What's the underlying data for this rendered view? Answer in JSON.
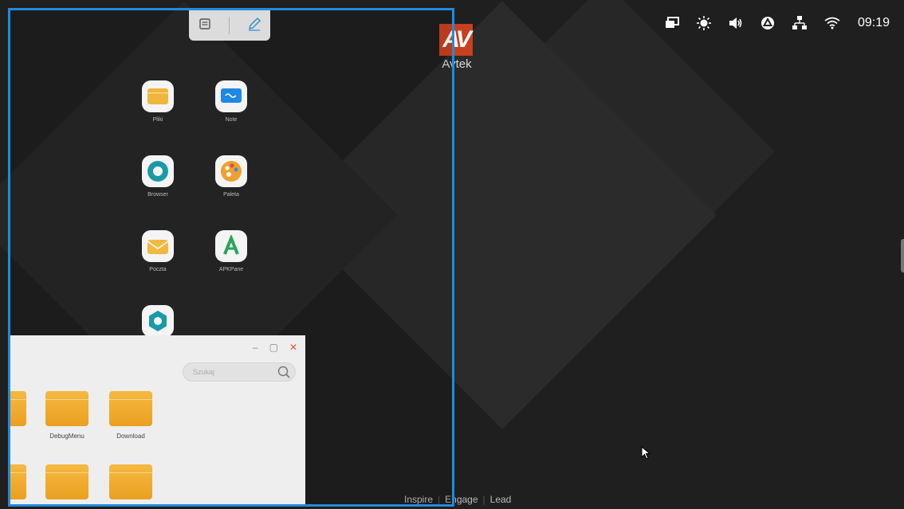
{
  "status_bar": {
    "icons": [
      "screen-mirror-icon",
      "brightness-icon",
      "volume-icon",
      "cloud-sync-icon",
      "ethernet-icon",
      "wifi-icon"
    ],
    "time": "09:19"
  },
  "logo": {
    "mark": "AV",
    "text": "Avtek"
  },
  "tagline": {
    "items": [
      "Inspire",
      "Engage",
      "Lead"
    ]
  },
  "apps": [
    {
      "label": "Pliki",
      "icon": "folder-icon",
      "bg": "#f0b63b"
    },
    {
      "label": "Note",
      "icon": "whiteboard-icon",
      "bg": "#1e88e5"
    },
    {
      "label": "Browser",
      "icon": "browser-icon",
      "bg": "#1a9aa7"
    },
    {
      "label": "Paleta",
      "icon": "palette-icon",
      "bg": "#f0a030"
    },
    {
      "label": "Poczta",
      "icon": "mail-icon",
      "bg": "#f2b840"
    },
    {
      "label": "APKPane",
      "icon": "apk-icon",
      "bg": "#2aa55a"
    },
    {
      "label": "",
      "icon": "settings-hex-icon",
      "bg": "#1a9aa7"
    }
  ],
  "file_manager": {
    "search_placeholder": "Szukaj",
    "folders_row1": [
      "",
      "DebugMenu",
      "Download"
    ],
    "folders_row2": [
      "",
      "",
      ""
    ]
  },
  "colors": {
    "accent": "#1d8ce0",
    "brand": "#c8401e"
  }
}
